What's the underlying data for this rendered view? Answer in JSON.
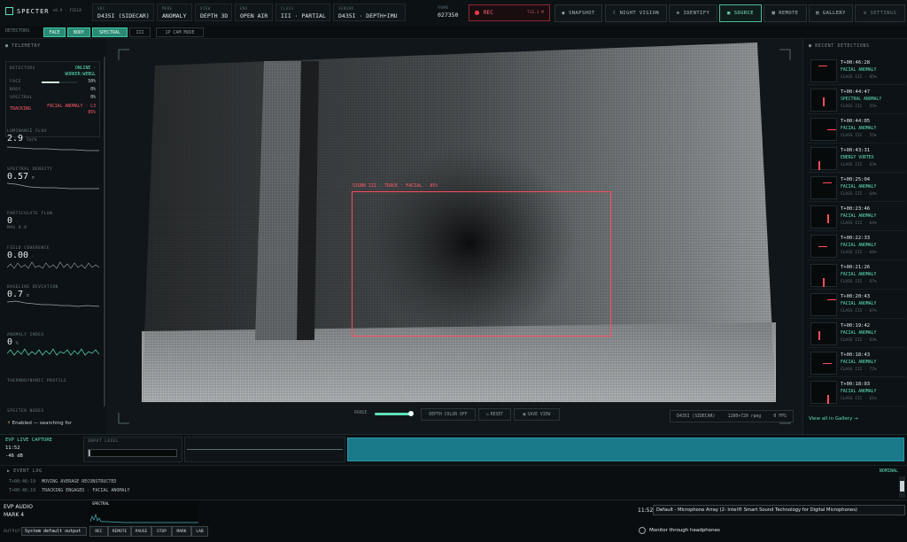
{
  "app": {
    "name": "SPECTER",
    "version": "v0.9 · FIELD"
  },
  "top_fields": [
    {
      "label": "SRC",
      "value": "D435I (SIDECAR)"
    },
    {
      "label": "MODE",
      "value": "ANOMALY"
    },
    {
      "label": "VIEW",
      "value": "DEPTH 3D"
    },
    {
      "label": "ENV",
      "value": "OPEN AIR"
    },
    {
      "label": "CLASS",
      "value": "III · PARTIAL"
    },
    {
      "label": "SENSOR",
      "value": "D435I · DEPTH+IMU"
    },
    {
      "label": "FRAME",
      "value": "027350"
    }
  ],
  "rec": {
    "label": "REC",
    "time": "T12.2 M"
  },
  "toolbar": [
    {
      "label": "SNAPSHOT",
      "icon": "camera-icon"
    },
    {
      "label": "NIGHT VISION",
      "icon": "moon-icon"
    },
    {
      "label": "IDENTIFY",
      "icon": "target-icon"
    },
    {
      "label": "SOURCE",
      "icon": "source-icon"
    },
    {
      "label": "REMOTE",
      "icon": "remote-icon"
    },
    {
      "label": "GALLERY",
      "icon": "gallery-icon"
    },
    {
      "label": "SETTINGS",
      "icon": "gear-icon"
    }
  ],
  "detectors_row": {
    "label": "DETECTORS",
    "chips": [
      "FACE",
      "BODY",
      "SPECTRAL",
      "III"
    ],
    "mode": "1P CAM MODE"
  },
  "telemetry": {
    "title": "TELEMETRY",
    "detectors_label": "DETECTORS",
    "status": "ONLINE · WORKER:WEBGL",
    "rows": [
      {
        "name": "FACE",
        "value": "50%",
        "level": 0.5
      },
      {
        "name": "BODY",
        "value": "0%",
        "level": 0
      },
      {
        "name": "SPECTRAL",
        "value": "0%",
        "level": 0
      }
    ],
    "tracking_label": "TRACKING",
    "tracking_value": "FACIAL ANOMALY · L3 · 85%",
    "metrics": [
      {
        "label": "LUMINANCE FLUX",
        "value": "2.9",
        "unit": "lx/s"
      },
      {
        "label": "SPECTRAL DENSITY",
        "value": "0.57",
        "unit": "σ"
      },
      {
        "label": "PARTICULATE FLOW",
        "value": "0",
        "unit": "·",
        "sub": "MAG 0.0"
      },
      {
        "label": "FIELD COHERENCE",
        "value": "0.00",
        "unit": "·"
      },
      {
        "label": "BASELINE DEVIATION",
        "value": "0.7",
        "unit": "σ"
      },
      {
        "label": "ANOMALY INDEX",
        "value": "0",
        "unit": "%"
      }
    ],
    "thermo_label": "THERMODYNAMIC PROFILE",
    "spectre_label": "SPECTER NODES",
    "spectre_status": "Enabled — searching for"
  },
  "viewer": {
    "box_label": "SIGMA III · TRACK · FACIAL · 85%",
    "range_label": "RANGE",
    "depth_btn": "DEPTH COLOR OFF",
    "reset_btn": "RESET",
    "save_btn": "SAVE VIEW",
    "status": "D435I (SIDECAR)",
    "res": "1280×720 rpeg",
    "fps": "0 FPS"
  },
  "recent": {
    "title": "RECENT DETECTIONS",
    "items": [
      {
        "time": "T+00:46:28",
        "type": "FACIAL ANOMALY",
        "cls": "CLASS III · 85%"
      },
      {
        "time": "T+00:44:47",
        "type": "SPECTRAL ANOMALY",
        "cls": "CLASS III · 55%"
      },
      {
        "time": "T+00:44:05",
        "type": "FACIAL ANOMALY",
        "cls": "CLASS III · 55%"
      },
      {
        "time": "T+00:43:31",
        "type": "ENERGY VORTEX",
        "cls": "CLASS III · 63%"
      },
      {
        "time": "T+00:25:04",
        "type": "FACIAL ANOMALY",
        "cls": "CLASS III · 64%"
      },
      {
        "time": "T+00:23:46",
        "type": "FACIAL ANOMALY",
        "cls": "CLASS III · 64%"
      },
      {
        "time": "T+00:22:33",
        "type": "FACIAL ANOMALY",
        "cls": "CLASS III · 64%"
      },
      {
        "time": "T+00:21:26",
        "type": "FACIAL ANOMALY",
        "cls": "CLASS III · 67%"
      },
      {
        "time": "T+00:20:43",
        "type": "FACIAL ANOMALY",
        "cls": "CLASS III · 67%"
      },
      {
        "time": "T+00:19:42",
        "type": "FACIAL ANOMALY",
        "cls": "CLASS III · 63%"
      },
      {
        "time": "T+00:18:43",
        "type": "FACIAL ANOMALY",
        "cls": "CLASS III · 72%"
      },
      {
        "time": "T+00:18:03",
        "type": "FACIAL ANOMALY",
        "cls": "CLASS III · 61%"
      }
    ],
    "view_all": "View all in Gallery →"
  },
  "evp": {
    "title": "EVP LIVE CAPTURE",
    "time": "11:52",
    "db": "-46 dB",
    "input_label": "INPUT LEVEL"
  },
  "event_log": {
    "title": "EVENT LOG",
    "status": "NOMINAL",
    "entries": [
      {
        "time": "T+00:46:19",
        "text": "MOVING AVERAGE RECONSTRUCTED"
      },
      {
        "time": "T+00:46:19",
        "text": "TRACKING ENGAGED · FACIAL ANOMALY"
      }
    ]
  },
  "audio": {
    "title": "EVP AUDIO",
    "mark": "MARK 4",
    "spectral_label": "SPECTRAL",
    "output_label": "OUTPUT",
    "output_value": "System default output",
    "buttons": [
      "REC",
      "REMOTE",
      "PAUSE",
      "STOP",
      "MARK",
      "LAB"
    ],
    "time": "11:52",
    "device": "Default - Microphone Array (2- Intel® Smart Sound Technology for Digital Microphones)",
    "monitor": "Monitor through headphones"
  },
  "colors": {
    "accent": "#5fe0b8",
    "alert": "#ff5a6a",
    "bg": "#0b0f12",
    "evp_bar": "#1b7a8a"
  }
}
